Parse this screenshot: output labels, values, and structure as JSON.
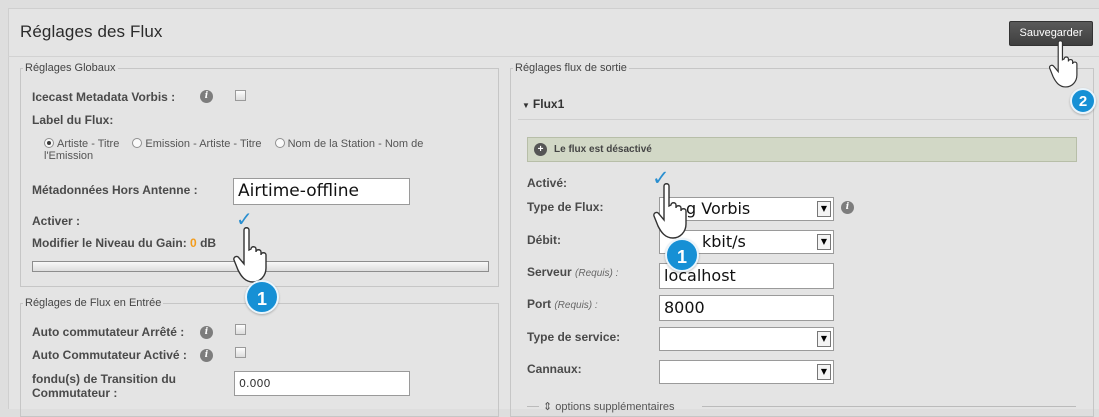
{
  "page": {
    "title": "Réglages des Flux"
  },
  "toolbar": {
    "save_label": "Sauvegarder"
  },
  "global": {
    "legend": "Réglages Globaux",
    "metadata_vorbis_label": "Icecast Metadata Vorbis :",
    "label_du_flux": "Label du Flux:",
    "radio_options": [
      "Artiste - Titre",
      "Emission - Artiste - Titre",
      "Nom de la Station - Nom de l'Emission"
    ],
    "radio_selected": 0,
    "offline_metadata_label": "Métadonnées Hors Antenne :",
    "offline_metadata_value": "Airtime-offline",
    "activer_label": "Activer :",
    "gain_label_prefix": "Modifier le Niveau du Gain:",
    "gain_value": "0",
    "gain_unit": "dB",
    "gain_slider_fraction": 0
  },
  "input": {
    "legend": "Réglages de Flux en Entrée",
    "auto_switch_off_label": "Auto commutateur Arrêté :",
    "auto_switch_on_label": "Auto Commutateur Activé :",
    "fade_label_line1": "fondu(s) de Transition du",
    "fade_label_line2": "Commutateur :",
    "fade_value": "0.000"
  },
  "output": {
    "legend": "Réglages flux de sortie",
    "flux_title": "Flux1",
    "status_text": "Le flux est désactivé",
    "active_label": "Activé:",
    "type_label": "Type de Flux:",
    "type_value": "g Vorbis",
    "bitrate_label": "Débit:",
    "bitrate_value": "kbit/s",
    "server_label": "Serveur",
    "server_req": "(Requis) :",
    "server_value": "localhost",
    "port_label": "Port",
    "port_req": "(Requis) :",
    "port_value": "8000",
    "service_label": "Type de service:",
    "channels_label": "Cannaux:",
    "extra_options": "options supplémentaires"
  },
  "annotations": {
    "badge_1": "1",
    "badge_2": "2"
  },
  "colors": {
    "accent_orange": "#f39c1b",
    "badge_blue": "#1690d5",
    "status_green": "#d2d8c6"
  }
}
